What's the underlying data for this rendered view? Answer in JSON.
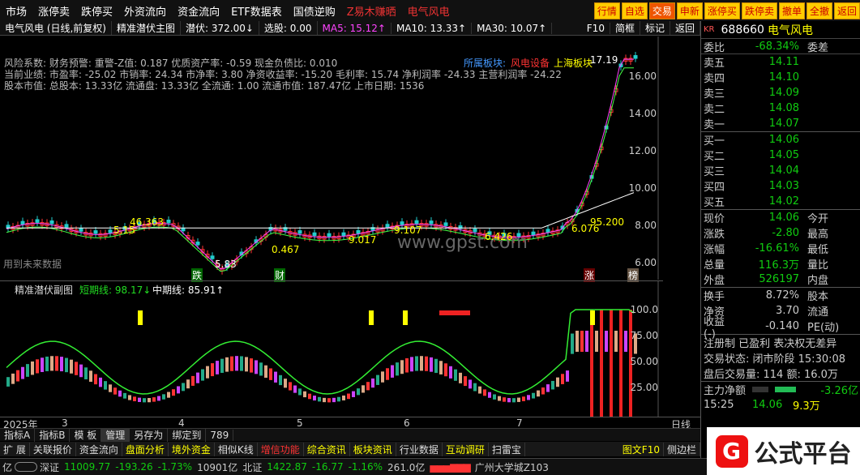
{
  "topmenu": {
    "items": [
      "市场",
      "涨停卖",
      "跌停买",
      "外资流向",
      "资金流向",
      "ETF数据表",
      "国债逆购"
    ],
    "alert": "Z易木赚晒",
    "stock_tag": "电气风电",
    "buttons": [
      "行情",
      "自选",
      "交易",
      "申新",
      "涨停买",
      "跌停卖",
      "撤单",
      "全撤",
      "返回"
    ]
  },
  "chartbar": {
    "periods": [
      "分时",
      "1分钟",
      "5分钟",
      "15分钟",
      "30分钟",
      "60分钟",
      "日线",
      "周线",
      "月线",
      "多周期",
      "更多"
    ],
    "tools": [
      "复权",
      "叠加",
      "多股",
      "统计",
      "画线",
      "F10",
      "简框",
      "标记",
      "返回"
    ]
  },
  "main_legend": {
    "title": "电气风电 (日线,前复权)",
    "indicator": "精准潜伏主图",
    "qf": "潜伏: 372.00↓",
    "xg": "选股: 0.00",
    "ma5": "MA5: 15.12↑",
    "ma10": "MA10: 13.33↑",
    "ma30": "MA30: 10.07↑"
  },
  "fund_info": [
    "风险系数: 财务预警: 重警-Z值: 0.187 优质资产率: -0.59 现金负债比: 0.010",
    "当前业绩: 市盈率: -25.02 市销率: 24.34 市净率: 3.80 净资收益率: -15.20 毛利率: 15.74 净利润率 -24.33 主营利润率 -24.22",
    "股本市值: 总股本: 13.33亿 流通盘: 13.33亿 全流通: 1.00 流通市值: 187.47亿 上市日期: 1536"
  ],
  "sector": {
    "label": "所属板块:",
    "s1": "风电设备",
    "s2": "上海板块"
  },
  "annotations": {
    "high": "17.19",
    "p1": "5.15",
    "p2": "46.363",
    "p3": "5.83",
    "p4": "0.467",
    "p5": "9.017",
    "p6": "9.107",
    "p7": "6.426",
    "p8": "6.076",
    "p9": "95.200",
    "future": "用到未来数据",
    "watermark": "www.gpst.com",
    "tag_d": "跌",
    "tag_c": "财",
    "tag_z": "涨",
    "tag_b": "榜"
  },
  "main_yaxis": [
    "16.00",
    "14.00",
    "12.00",
    "10.00",
    "8.00",
    "6.00"
  ],
  "sub_legend": {
    "title": "精准潜伏副图",
    "short": "短期线: 98.17↓",
    "mid": "中期线: 85.91↑"
  },
  "sub_yaxis": [
    "100.0",
    "75.00",
    "50.00",
    "25.00"
  ],
  "xaxis": {
    "year": "2025年",
    "months": [
      "3",
      "4",
      "5",
      "6",
      "7"
    ],
    "mode": "日线"
  },
  "tabs": [
    "指标A",
    "指标B",
    "模 板",
    "管理",
    "另存为",
    "绑定到",
    "789"
  ],
  "tabs2": [
    "扩 展",
    "关联报价",
    "资金流向",
    "盘面分析",
    "境外资金",
    "相似K线",
    "增信功能",
    "综合资讯",
    "板块资讯",
    "行业数据",
    "互动调研",
    "扫雷宝",
    "图文F10",
    "侧边栏"
  ],
  "right": {
    "code": "688660",
    "name": "电气风电",
    "wb_label": "委比",
    "wb": "-68.34%",
    "wc_label": "委差",
    "asks": [
      {
        "k": "卖五",
        "p": "14.11"
      },
      {
        "k": "卖四",
        "p": "14.10"
      },
      {
        "k": "卖三",
        "p": "14.09"
      },
      {
        "k": "卖二",
        "p": "14.08"
      },
      {
        "k": "卖一",
        "p": "14.07"
      }
    ],
    "bids": [
      {
        "k": "买一",
        "p": "14.06"
      },
      {
        "k": "买二",
        "p": "14.05"
      },
      {
        "k": "买三",
        "p": "14.04"
      },
      {
        "k": "买四",
        "p": "14.03"
      },
      {
        "k": "买五",
        "p": "14.02"
      }
    ],
    "stats": [
      {
        "k": "现价",
        "v": "14.06",
        "k2": "今开"
      },
      {
        "k": "涨跌",
        "v": "-2.80",
        "k2": "最高"
      },
      {
        "k": "涨幅",
        "v": "-16.61%",
        "k2": "最低"
      },
      {
        "k": "总量",
        "v": "116.3万",
        "k2": "量比"
      },
      {
        "k": "外盘",
        "v": "526197",
        "k2": "内盘"
      }
    ],
    "stats2": [
      {
        "k": "换手",
        "v": "8.72%",
        "k2": "股本"
      },
      {
        "k": "净资",
        "v": "3.70",
        "k2": "流通"
      },
      {
        "k": "收益(-)",
        "v": "-0.140",
        "k2": "PE(动)"
      }
    ],
    "flags": "注册制 已盈利 表决权无差异",
    "trade_state": "交易状态: 闭市阶段 15:30:08",
    "after": "盘后交易量: 114  额: 16.0万",
    "net_label": "主力净额",
    "net": "-3.26亿",
    "last_time": "15:25",
    "last_p": "14.06",
    "last_v": "9.3万"
  },
  "status": {
    "sz_label": "深证",
    "sz": "11009.77",
    "sz_chg": "-193.26",
    "sz_pct": "-1.73%",
    "sz_amt": "10901亿",
    "bz_label": "北证",
    "bz": "1422.87",
    "bz_chg": "-16.77",
    "bz_pct": "-1.16%",
    "bz_amt": "261.0亿",
    "pre": "亿",
    "place": "广州大学城Z103"
  },
  "logo_text": "公式平台",
  "colors": {
    "up": "#ff3333",
    "down": "#22cc22",
    "ma5": "#ff44ff",
    "ma10": "#44ff44",
    "ma30": "#ffffff"
  }
}
